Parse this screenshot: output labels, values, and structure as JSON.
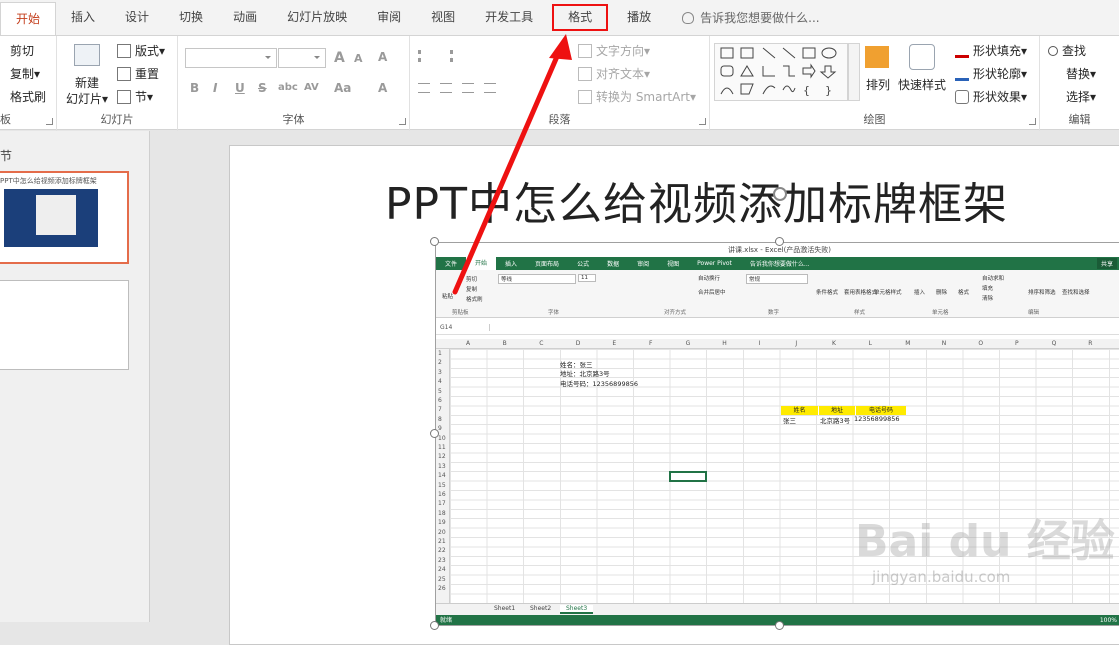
{
  "tabs": [
    {
      "label": "开始",
      "active": true
    },
    {
      "label": "插入"
    },
    {
      "label": "设计"
    },
    {
      "label": "切换"
    },
    {
      "label": "动画"
    },
    {
      "label": "幻灯片放映"
    },
    {
      "label": "审阅"
    },
    {
      "label": "视图"
    },
    {
      "label": "开发工具"
    },
    {
      "label": "格式",
      "highlighted": true
    },
    {
      "label": "播放"
    }
  ],
  "tellme": {
    "placeholder": "告诉我您想要做什么..."
  },
  "ribbon": {
    "clipboard": {
      "cut": "剪切",
      "copy": "复制",
      "format_painter": "格式刷",
      "title": "板"
    },
    "slides": {
      "new_slide": "新建",
      "new_slide_line2": "幻灯片",
      "layout": "版式",
      "reset": "重置",
      "section": "节",
      "title": "幻灯片"
    },
    "font": {
      "title": "字体",
      "bold": "B",
      "italic": "I",
      "underline": "U",
      "strike": "S",
      "shadow": "abc",
      "spacing": "AV",
      "case": "Aa",
      "color": "A",
      "grow": "A",
      "shrink": "A",
      "clear": "A"
    },
    "paragraph": {
      "text_direction": "文字方向",
      "align_text": "对齐文本",
      "smartart": "转换为 SmartArt",
      "title": "段落"
    },
    "drawing": {
      "arrange": "排列",
      "quick_styles": "快速样式",
      "shape_fill": "形状填充",
      "shape_outline": "形状轮廓",
      "shape_effects": "形状效果",
      "title": "绘图"
    },
    "editing": {
      "find": "查找",
      "replace": "替换",
      "select": "选择",
      "title": "编辑"
    }
  },
  "left_pane": {
    "section_label": "节",
    "thumb1_caption": "PPT中怎么给视频添加标牌框架"
  },
  "slide": {
    "title": "PPT中怎么给视频添加标牌框架"
  },
  "video": {
    "window_title": "讲课.xlsx - Excel(产品激活失败)",
    "tabs": [
      "文件",
      "开始",
      "插入",
      "页面布局",
      "公式",
      "数据",
      "审阅",
      "视图",
      "Power Pivot"
    ],
    "tellme": "告诉我你想要做什么...",
    "share": "共享",
    "ribbon_groups": [
      "剪贴板",
      "字体",
      "对齐方式",
      "数字",
      "样式",
      "单元格",
      "编辑"
    ],
    "ribbon_items": {
      "paste": "粘贴",
      "cut": "剪切",
      "copy": "复制",
      "format_painter": "格式刷",
      "font_name": "等线",
      "font_size": "11",
      "wrap": "自动换行",
      "merge": "合并后居中",
      "number_format": "常规",
      "cond_format": "条件格式",
      "table_format": "套用表格格式",
      "cell_styles": "单元格样式",
      "insert": "插入",
      "delete": "删除",
      "format": "格式",
      "autosum": "自动求和",
      "fill": "填充",
      "clear": "清除",
      "sort_filter": "排序和筛选",
      "find_select": "查找和选择"
    },
    "name_box": "G14",
    "columns": [
      "A",
      "B",
      "C",
      "D",
      "E",
      "F",
      "G",
      "H",
      "I",
      "J",
      "K",
      "L",
      "M",
      "N",
      "O",
      "P",
      "Q",
      "R"
    ],
    "rows": [
      "1",
      "2",
      "3",
      "4",
      "5",
      "6",
      "7",
      "8",
      "9",
      "10",
      "11",
      "12",
      "13",
      "14",
      "15",
      "16",
      "17",
      "18",
      "19",
      "20",
      "21",
      "22",
      "23",
      "24",
      "25",
      "26"
    ],
    "cells": {
      "d2": "姓名：张三",
      "d3": "地址：北京路3号",
      "d4": "电话号码：12356899856",
      "hdr_name": "姓名",
      "hdr_addr": "地址",
      "hdr_phone": "电话号码",
      "row_name": "张三",
      "row_addr": "北京路3号",
      "row_phone": "12356899856"
    },
    "sheets": [
      "Sheet1",
      "Sheet2",
      "Sheet3"
    ],
    "status": "就绪",
    "zoom": "100%"
  },
  "watermark": {
    "main": "Bai du 经验",
    "sub": "jingyan.baidu.com"
  },
  "colors": {
    "accent": "#c43e1c",
    "highlight": "#ee1111",
    "excel_green": "#217346",
    "yellow": "#ffeb00"
  }
}
